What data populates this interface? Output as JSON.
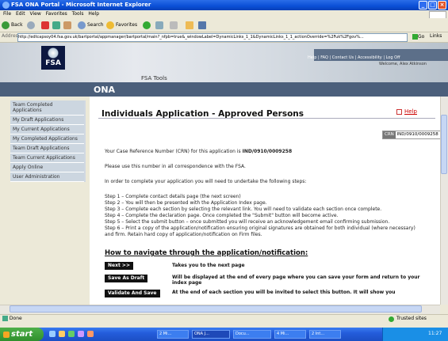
{
  "window": {
    "title": "FSA ONA Portal - Microsoft Internet Explorer"
  },
  "menu": [
    "File",
    "Edit",
    "View",
    "Favorites",
    "Tools",
    "Help"
  ],
  "toolbar": {
    "back": "Back",
    "search": "Search",
    "favorites": "Favorites"
  },
  "address": {
    "label": "Address",
    "url": "http://edtcapsoy04.fsa.gov.uk/bartportal/appmanager/bartportal/main?_nfpb=true&_windowLabel=DynamicLinks_1_1&DynamicLinks_1_1_actionOverride=%2Fuk%2Fgov%...",
    "go": "Go",
    "links": "Links"
  },
  "banner": {
    "logo": "FSA",
    "tools": "FSA Tools",
    "links": "Help | FAQ | Contact Us | Accessibility | Log Off",
    "welcome": "Welcome, Alex Atkinson"
  },
  "app": {
    "name": "ONA"
  },
  "sidebar": {
    "items": [
      {
        "label": "Team Completed Applications"
      },
      {
        "label": "My Draft Applications"
      },
      {
        "label": "My Current Applications"
      },
      {
        "label": "My Completed Applications"
      },
      {
        "label": "Team Draft Applications"
      },
      {
        "label": "Team Current Applications"
      },
      {
        "label": "Apply Online"
      },
      {
        "label": "User Administration"
      }
    ]
  },
  "main": {
    "title": "Individuals Application - Approved Persons",
    "help": "Help",
    "crn_label": "CRN",
    "crn_value": "IND/0910/0009258",
    "crn_text_pre": "Your Case Reference Number (CRN) for this application is ",
    "crn_text_bold": "IND/0910/0009258",
    "p2": "Please use this number in all correspondence with the FSA.",
    "p3": "In order to complete your application you will need to undertake the following steps:",
    "steps": [
      "Step 1 – Complete contact details page (the next screen)",
      "Step 2 – You will then be presented with the Application Index page.",
      "Step 3 – Complete each section by selecting the relevant link. You will need to validate each section once complete.",
      "Step 4 – Complete the declaration page. Once completed the \"Submit\" button will become active.",
      "Step 5 – Select the submit button – once submitted you will receive an acknowledgement email confirming submission.",
      "Step 6 – Print a copy of the application/notification ensuring original signatures are obtained for both individual (where necessary)",
      "and firm. Retain hard copy of application/notification on Firm files."
    ],
    "howto": "How to navigate through the application/notification:",
    "nav": [
      {
        "btn": "Next >>",
        "desc": "Takes you to the next page"
      },
      {
        "btn": "Save As Draft",
        "desc": "Will be displayed at the end of every page where you can save your form and return to your index page"
      },
      {
        "btn": "Validate And Save",
        "desc": "At the end of each section you will be invited to select this button. It will show you"
      }
    ]
  },
  "status": {
    "left": "Done",
    "right": "Trusted sites"
  },
  "taskbar": {
    "start": "start",
    "tasks": [
      "2 Mi...",
      "ONA J...",
      "Docu...",
      "4 Mi...",
      "2 Int..."
    ],
    "clock": "11:27"
  }
}
